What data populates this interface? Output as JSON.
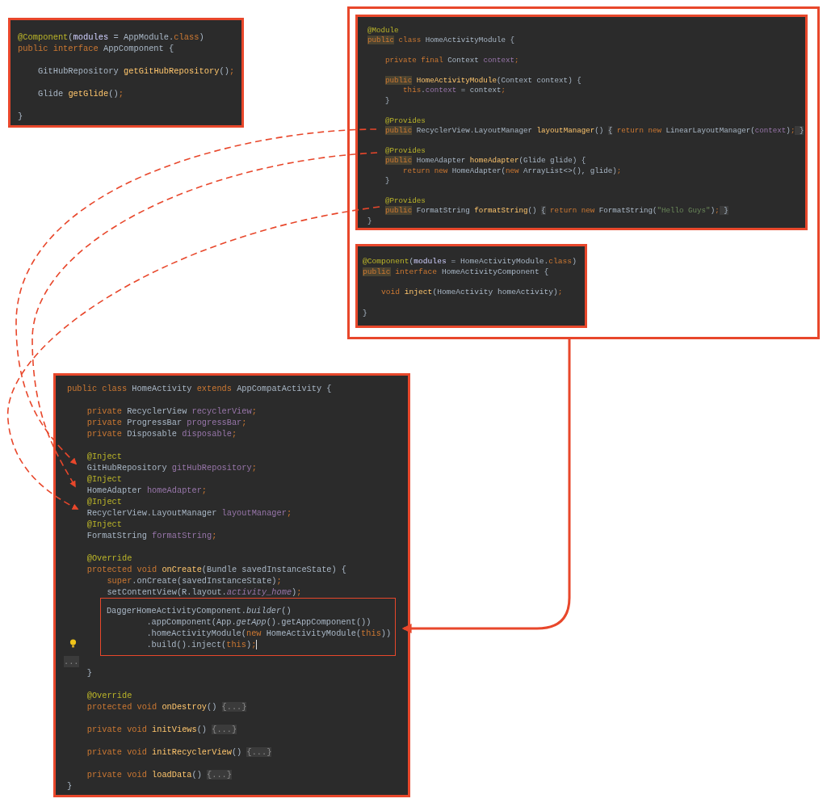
{
  "panels": [
    {
      "lines": [
        {
          "kind": "code",
          "tokens": [
            {
              "kind": "a",
              "text": "@Component"
            },
            {
              "kind": "p",
              "text": "("
            },
            {
              "kind": "n",
              "text": "modules"
            },
            {
              "kind": "p",
              "text": " = AppModule."
            },
            {
              "kind": "k",
              "text": "class"
            },
            {
              "kind": "p",
              "text": ")"
            }
          ]
        },
        {
          "kind": "code",
          "tokens": [
            {
              "kind": "k",
              "text": "public interface "
            },
            {
              "kind": "p",
              "text": "AppComponent {"
            }
          ]
        },
        {
          "kind": "blank"
        },
        {
          "kind": "code",
          "tokens": [
            {
              "kind": "p",
              "text": "    GitHubRepository "
            },
            {
              "kind": "m",
              "text": "getGitHubRepository"
            },
            {
              "kind": "p",
              "text": "()"
            },
            {
              "kind": "k",
              "text": ";"
            }
          ]
        },
        {
          "kind": "blank"
        },
        {
          "kind": "code",
          "tokens": [
            {
              "kind": "p",
              "text": "    Glide "
            },
            {
              "kind": "m",
              "text": "getGlide"
            },
            {
              "kind": "p",
              "text": "()"
            },
            {
              "kind": "k",
              "text": ";"
            }
          ]
        },
        {
          "kind": "blank"
        },
        {
          "kind": "code",
          "tokens": [
            {
              "kind": "p",
              "text": "}"
            }
          ]
        }
      ]
    },
    {
      "lines": [
        {
          "kind": "code",
          "tokens": [
            {
              "kind": "a",
              "text": "@Module"
            }
          ]
        },
        {
          "kind": "code",
          "tokens": [
            {
              "kind": "kh",
              "text": "public"
            },
            {
              "kind": "k",
              "text": " class "
            },
            {
              "kind": "p",
              "text": "HomeActivityModule {"
            }
          ]
        },
        {
          "kind": "blank"
        },
        {
          "kind": "code",
          "tokens": [
            {
              "kind": "k",
              "text": "    private final "
            },
            {
              "kind": "p",
              "text": "Context "
            },
            {
              "kind": "f",
              "text": "context"
            },
            {
              "kind": "k",
              "text": ";"
            }
          ]
        },
        {
          "kind": "blank"
        },
        {
          "kind": "code",
          "tokens": [
            {
              "kind": "kh",
              "text": "    public"
            },
            {
              "kind": "m",
              "text": " HomeActivityModule"
            },
            {
              "kind": "p",
              "text": "(Context context) {"
            }
          ]
        },
        {
          "kind": "code",
          "tokens": [
            {
              "kind": "k",
              "text": "        this"
            },
            {
              "kind": "p",
              "text": "."
            },
            {
              "kind": "f",
              "text": "context"
            },
            {
              "kind": "p",
              "text": " = context"
            },
            {
              "kind": "k",
              "text": ";"
            }
          ]
        },
        {
          "kind": "code",
          "tokens": [
            {
              "kind": "p",
              "text": "    }"
            }
          ]
        },
        {
          "kind": "blank"
        },
        {
          "kind": "code",
          "tokens": [
            {
              "kind": "a",
              "text": "    @Provides"
            }
          ]
        },
        {
          "kind": "code",
          "tokens": [
            {
              "kind": "kh",
              "text": "    public"
            },
            {
              "kind": "p",
              "text": " RecyclerView.LayoutManager "
            },
            {
              "kind": "m",
              "text": "layoutManager"
            },
            {
              "kind": "p",
              "text": "() "
            },
            {
              "kind": "fb",
              "text": "{"
            },
            {
              "kind": "k",
              "text": " return new "
            },
            {
              "kind": "p",
              "text": "LinearLayoutManager("
            },
            {
              "kind": "f",
              "text": "context"
            },
            {
              "kind": "p",
              "text": ")"
            },
            {
              "kind": "k",
              "text": ";"
            },
            {
              "kind": "fb",
              "text": " }"
            }
          ]
        },
        {
          "kind": "blank"
        },
        {
          "kind": "code",
          "tokens": [
            {
              "kind": "a",
              "text": "    @Provides"
            }
          ]
        },
        {
          "kind": "code",
          "tokens": [
            {
              "kind": "kh",
              "text": "    public"
            },
            {
              "kind": "p",
              "text": " HomeAdapter "
            },
            {
              "kind": "m",
              "text": "homeAdapter"
            },
            {
              "kind": "p",
              "text": "(Glide glide) {"
            }
          ]
        },
        {
          "kind": "code",
          "tokens": [
            {
              "kind": "k",
              "text": "        return new "
            },
            {
              "kind": "p",
              "text": "HomeAdapter("
            },
            {
              "kind": "k",
              "text": "new "
            },
            {
              "kind": "p",
              "text": "ArrayList<>(), glide)"
            },
            {
              "kind": "k",
              "text": ";"
            }
          ]
        },
        {
          "kind": "code",
          "tokens": [
            {
              "kind": "p",
              "text": "    }"
            }
          ]
        },
        {
          "kind": "blank"
        },
        {
          "kind": "code",
          "tokens": [
            {
              "kind": "a",
              "text": "    @Provides"
            }
          ]
        },
        {
          "kind": "code",
          "tokens": [
            {
              "kind": "kh",
              "text": "    public"
            },
            {
              "kind": "p",
              "text": " FormatString "
            },
            {
              "kind": "m",
              "text": "formatString"
            },
            {
              "kind": "p",
              "text": "() "
            },
            {
              "kind": "fb",
              "text": "{"
            },
            {
              "kind": "k",
              "text": " return new "
            },
            {
              "kind": "p",
              "text": "FormatString("
            },
            {
              "kind": "s",
              "text": "\"Hello Guys\""
            },
            {
              "kind": "p",
              "text": ")"
            },
            {
              "kind": "k",
              "text": ";"
            },
            {
              "kind": "fb",
              "text": " }"
            }
          ]
        },
        {
          "kind": "code",
          "tokens": [
            {
              "kind": "p",
              "text": "}"
            }
          ]
        }
      ]
    },
    {
      "lines": [
        {
          "kind": "code",
          "tokens": [
            {
              "kind": "a",
              "text": "@Component"
            },
            {
              "kind": "p",
              "text": "("
            },
            {
              "kind": "n",
              "text": "modules"
            },
            {
              "kind": "p",
              "text": " = HomeActivityModule."
            },
            {
              "kind": "k",
              "text": "class"
            },
            {
              "kind": "p",
              "text": ")"
            }
          ]
        },
        {
          "kind": "code",
          "tokens": [
            {
              "kind": "kh",
              "text": "public"
            },
            {
              "kind": "k",
              "text": " interface "
            },
            {
              "kind": "p",
              "text": "HomeActivityComponent {"
            }
          ]
        },
        {
          "kind": "blank"
        },
        {
          "kind": "code",
          "tokens": [
            {
              "kind": "k",
              "text": "    void "
            },
            {
              "kind": "m",
              "text": "inject"
            },
            {
              "kind": "p",
              "text": "(HomeActivity homeActivity)"
            },
            {
              "kind": "k",
              "text": ";"
            }
          ]
        },
        {
          "kind": "blank"
        },
        {
          "kind": "code",
          "tokens": [
            {
              "kind": "p",
              "text": "}"
            }
          ]
        }
      ]
    },
    {
      "lines": [
        {
          "kind": "code",
          "tokens": [
            {
              "kind": "k",
              "text": "public class "
            },
            {
              "kind": "p",
              "text": "HomeActivity "
            },
            {
              "kind": "k",
              "text": "extends "
            },
            {
              "kind": "p",
              "text": "AppCompatActivity {"
            }
          ]
        },
        {
          "kind": "blank"
        },
        {
          "kind": "code",
          "tokens": [
            {
              "kind": "k",
              "text": "    private "
            },
            {
              "kind": "p",
              "text": "RecyclerView "
            },
            {
              "kind": "f",
              "text": "recyclerView"
            },
            {
              "kind": "k",
              "text": ";"
            }
          ]
        },
        {
          "kind": "code",
          "tokens": [
            {
              "kind": "k",
              "text": "    private "
            },
            {
              "kind": "p",
              "text": "ProgressBar "
            },
            {
              "kind": "f",
              "text": "progressBar"
            },
            {
              "kind": "k",
              "text": ";"
            }
          ]
        },
        {
          "kind": "code",
          "tokens": [
            {
              "kind": "k",
              "text": "    private "
            },
            {
              "kind": "p",
              "text": "Disposable "
            },
            {
              "kind": "f",
              "text": "disposable"
            },
            {
              "kind": "k",
              "text": ";"
            }
          ]
        },
        {
          "kind": "blank"
        },
        {
          "kind": "code",
          "tokens": [
            {
              "kind": "a",
              "text": "    @Inject"
            }
          ]
        },
        {
          "kind": "code",
          "tokens": [
            {
              "kind": "p",
              "text": "    GitHubRepository "
            },
            {
              "kind": "f",
              "text": "gitHubRepository"
            },
            {
              "kind": "k",
              "text": ";"
            }
          ]
        },
        {
          "kind": "code",
          "tokens": [
            {
              "kind": "a",
              "text": "    @Inject"
            }
          ]
        },
        {
          "kind": "code",
          "tokens": [
            {
              "kind": "p",
              "text": "    HomeAdapter "
            },
            {
              "kind": "f",
              "text": "homeAdapter"
            },
            {
              "kind": "k",
              "text": ";"
            }
          ]
        },
        {
          "kind": "code",
          "tokens": [
            {
              "kind": "a",
              "text": "    @Inject"
            }
          ]
        },
        {
          "kind": "code",
          "tokens": [
            {
              "kind": "p",
              "text": "    RecyclerView.LayoutManager "
            },
            {
              "kind": "f",
              "text": "layoutManager"
            },
            {
              "kind": "k",
              "text": ";"
            }
          ]
        },
        {
          "kind": "code",
          "tokens": [
            {
              "kind": "a",
              "text": "    @Inject"
            }
          ]
        },
        {
          "kind": "code",
          "tokens": [
            {
              "kind": "p",
              "text": "    FormatString "
            },
            {
              "kind": "f",
              "text": "formatString"
            },
            {
              "kind": "k",
              "text": ";"
            }
          ]
        },
        {
          "kind": "blank"
        },
        {
          "kind": "code",
          "tokens": [
            {
              "kind": "a",
              "text": "    @Override"
            }
          ]
        },
        {
          "kind": "code",
          "tokens": [
            {
              "kind": "k",
              "text": "    protected void "
            },
            {
              "kind": "m",
              "text": "onCreate"
            },
            {
              "kind": "p",
              "text": "(Bundle savedInstanceState) {"
            }
          ]
        },
        {
          "kind": "code",
          "tokens": [
            {
              "kind": "k",
              "text": "        super"
            },
            {
              "kind": "p",
              "text": ".onCreate(savedInstanceState)"
            },
            {
              "kind": "k",
              "text": ";"
            }
          ]
        },
        {
          "kind": "code",
          "tokens": [
            {
              "kind": "p",
              "text": "        setContentView(R.layout."
            },
            {
              "kind": "fi",
              "text": "activity_home"
            },
            {
              "kind": "p",
              "text": ")"
            },
            {
              "kind": "k",
              "text": ";"
            }
          ]
        },
        {
          "kind": "highlight",
          "lines": [
            {
              "kind": "code",
              "tokens": [
                {
                  "kind": "p",
                  "text": "        DaggerHomeActivityComponent."
                },
                {
                  "kind": "pi",
                  "text": "builder"
                },
                {
                  "kind": "p",
                  "text": "()"
                }
              ]
            },
            {
              "kind": "code",
              "tokens": [
                {
                  "kind": "p",
                  "text": "                .appComponent(App."
                },
                {
                  "kind": "pi",
                  "text": "getApp"
                },
                {
                  "kind": "p",
                  "text": "().getAppComponent())"
                }
              ]
            },
            {
              "kind": "code",
              "tokens": [
                {
                  "kind": "p",
                  "text": "                .homeActivityModule("
                },
                {
                  "kind": "k",
                  "text": "new "
                },
                {
                  "kind": "p",
                  "text": "HomeActivityModule("
                },
                {
                  "kind": "k",
                  "text": "this"
                },
                {
                  "kind": "p",
                  "text": "))"
                }
              ]
            },
            {
              "kind": "code",
              "cursor": true,
              "bulb": true,
              "tokens": [
                {
                  "kind": "p",
                  "text": "                .build().inject("
                },
                {
                  "kind": "k",
                  "text": "this"
                },
                {
                  "kind": "p",
                  "text": ")"
                },
                {
                  "kind": "k",
                  "text": ";"
                }
              ]
            }
          ]
        },
        {
          "kind": "code",
          "tokens": [
            {
              "kind": "fold",
              "text": "..."
            }
          ]
        },
        {
          "kind": "code",
          "tokens": [
            {
              "kind": "p",
              "text": "    }"
            }
          ]
        },
        {
          "kind": "blank"
        },
        {
          "kind": "code",
          "tokens": [
            {
              "kind": "a",
              "text": "    @Override"
            }
          ]
        },
        {
          "kind": "code",
          "tokens": [
            {
              "kind": "k",
              "text": "    protected void "
            },
            {
              "kind": "m",
              "text": "onDestroy"
            },
            {
              "kind": "p",
              "text": "() "
            },
            {
              "kind": "fold",
              "text": "{...}"
            }
          ]
        },
        {
          "kind": "blank"
        },
        {
          "kind": "code",
          "tokens": [
            {
              "kind": "k",
              "text": "    private void "
            },
            {
              "kind": "m",
              "text": "initViews"
            },
            {
              "kind": "p",
              "text": "() "
            },
            {
              "kind": "fold",
              "text": "{...}"
            }
          ]
        },
        {
          "kind": "blank"
        },
        {
          "kind": "code",
          "tokens": [
            {
              "kind": "k",
              "text": "    private void "
            },
            {
              "kind": "m",
              "text": "initRecyclerView"
            },
            {
              "kind": "p",
              "text": "() "
            },
            {
              "kind": "fold",
              "text": "{...}"
            }
          ]
        },
        {
          "kind": "blank"
        },
        {
          "kind": "code",
          "tokens": [
            {
              "kind": "k",
              "text": "    private void "
            },
            {
              "kind": "m",
              "text": "loadData"
            },
            {
              "kind": "p",
              "text": "() "
            },
            {
              "kind": "fold",
              "text": "{...}"
            }
          ]
        },
        {
          "kind": "code",
          "tokens": [
            {
              "kind": "p",
              "text": "}"
            }
          ]
        }
      ]
    }
  ]
}
